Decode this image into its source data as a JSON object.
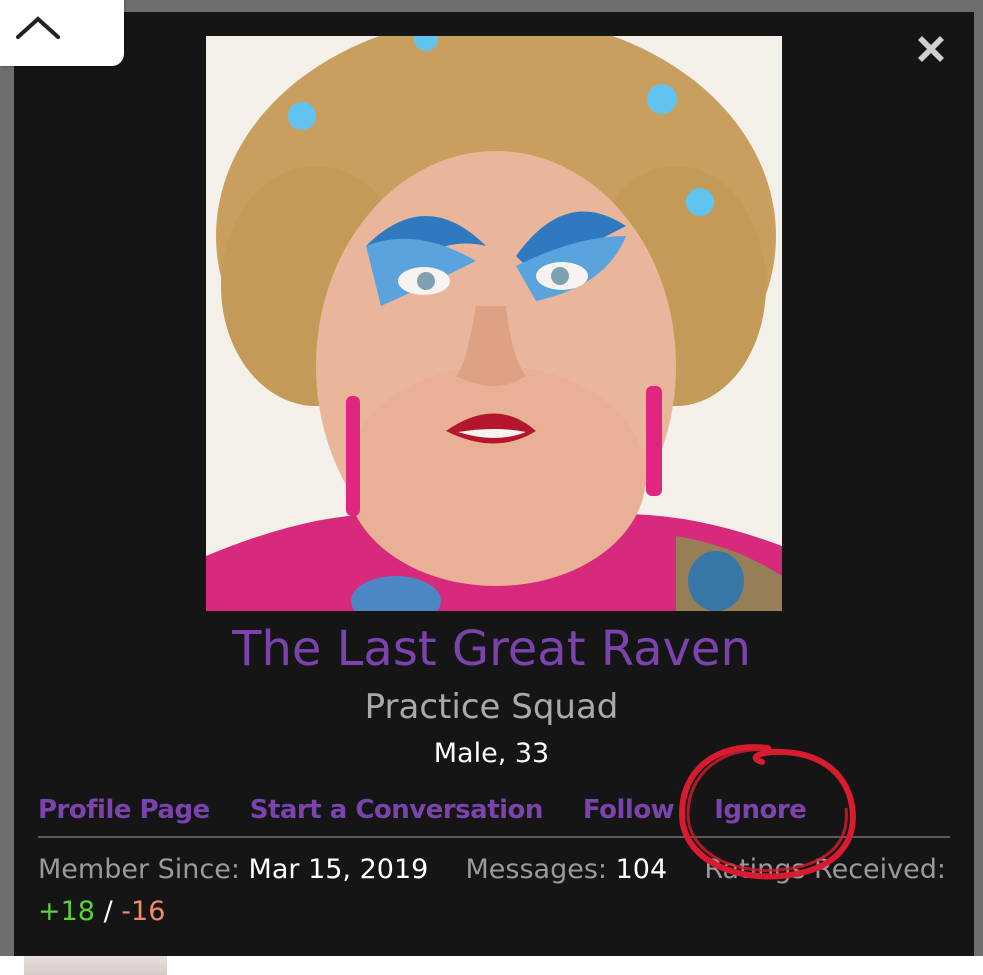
{
  "profile": {
    "name": "The Last Great Raven",
    "title": "Practice Squad",
    "demographics": "Male, 33"
  },
  "links": [
    "Profile Page",
    "Start a Conversation",
    "Follow",
    "Ignore"
  ],
  "stats": {
    "member_since_label": "Member Since:",
    "member_since_value": "Mar 15, 2019",
    "messages_label": "Messages:",
    "messages_value": "104",
    "ratings_label": "Ratings Received:",
    "ratings_positive": "+18",
    "ratings_separator": "/",
    "ratings_negative": "-16"
  },
  "icons": {
    "collapse": "chevron-up-icon",
    "close": "close-icon"
  },
  "colors": {
    "accent": "#7b43ad",
    "positive": "#5fcf3a",
    "negative": "#f08a6a",
    "annotation": "#d81b2f"
  }
}
